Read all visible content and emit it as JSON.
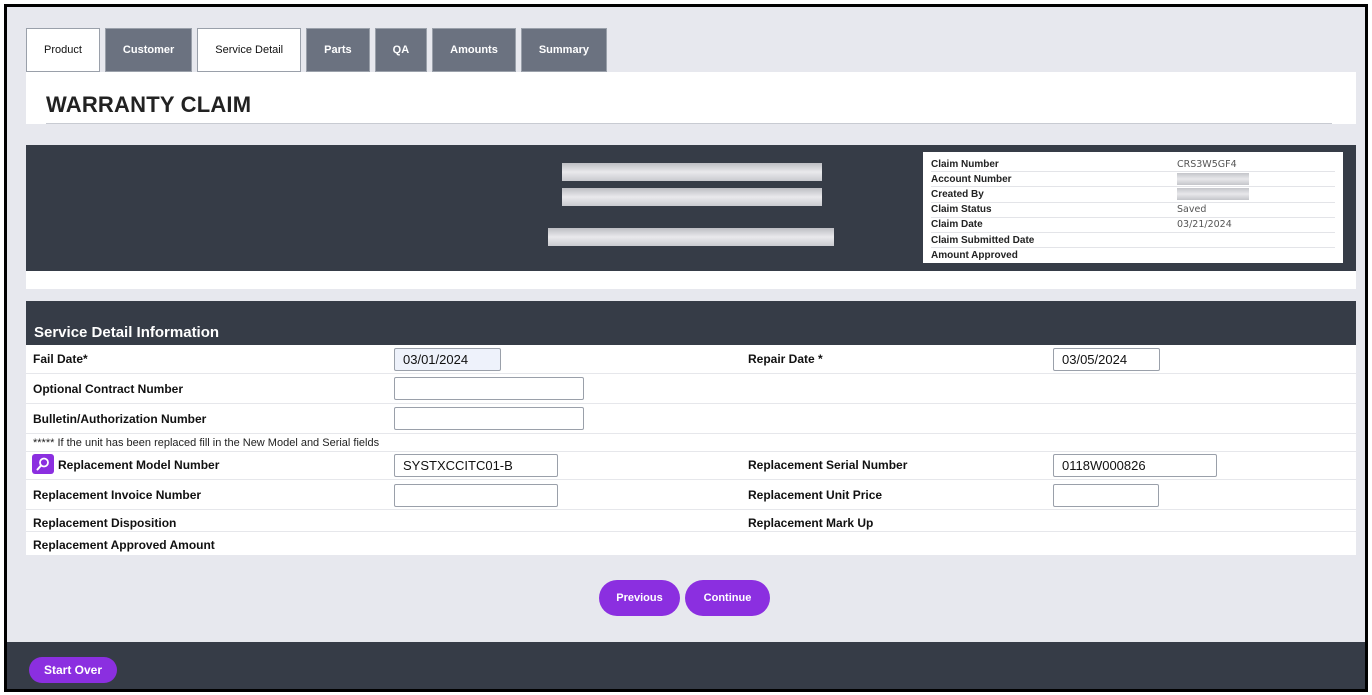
{
  "tabs": [
    {
      "label": "Product",
      "style": "light"
    },
    {
      "label": "Customer",
      "style": "dark"
    },
    {
      "label": "Service Detail",
      "style": "light"
    },
    {
      "label": "Parts",
      "style": "dark"
    },
    {
      "label": "QA",
      "style": "dark"
    },
    {
      "label": "Amounts",
      "style": "dark"
    },
    {
      "label": "Summary",
      "style": "dark"
    }
  ],
  "page_title": "WARRANTY CLAIM",
  "claim_info": [
    {
      "label": "Claim Number",
      "value": "CRS3W5GF4"
    },
    {
      "label": "Account Number",
      "value": ""
    },
    {
      "label": "Created By",
      "value": ""
    },
    {
      "label": "Claim Status",
      "value": "Saved"
    },
    {
      "label": "Claim Date",
      "value": "03/21/2024"
    },
    {
      "label": "Claim Submitted Date",
      "value": ""
    },
    {
      "label": "Amount Approved",
      "value": ""
    }
  ],
  "section": {
    "title": "Service Detail Information",
    "fail_date_label": "Fail Date*",
    "fail_date_value": "03/01/2024",
    "repair_date_label": "Repair Date *",
    "repair_date_value": "03/05/2024",
    "optional_contract_label": "Optional Contract Number",
    "optional_contract_value": "",
    "bulletin_label": "Bulletin/Authorization Number",
    "bulletin_value": "",
    "note": "***** If the unit has been replaced fill in the New Model and Serial fields",
    "replacement_model_label": "Replacement Model Number",
    "replacement_model_value": "SYSTXCCITC01-B",
    "replacement_serial_label": "Replacement Serial Number",
    "replacement_serial_value": "0118W000826",
    "replacement_invoice_label": "Replacement Invoice Number",
    "replacement_invoice_value": "",
    "replacement_unit_price_label": "Replacement Unit Price",
    "replacement_unit_price_value": "",
    "replacement_disposition_label": "Replacement Disposition",
    "replacement_markup_label": "Replacement Mark Up",
    "replacement_approved_label": "Replacement Approved Amount"
  },
  "buttons": {
    "previous": "Previous",
    "continue": "Continue",
    "start_over": "Start Over"
  },
  "colors": {
    "accent": "#8b2fe0",
    "dark_panel": "#363c47",
    "tab_dark": "#6b7280"
  },
  "icons": {
    "lookup": "search-icon"
  }
}
